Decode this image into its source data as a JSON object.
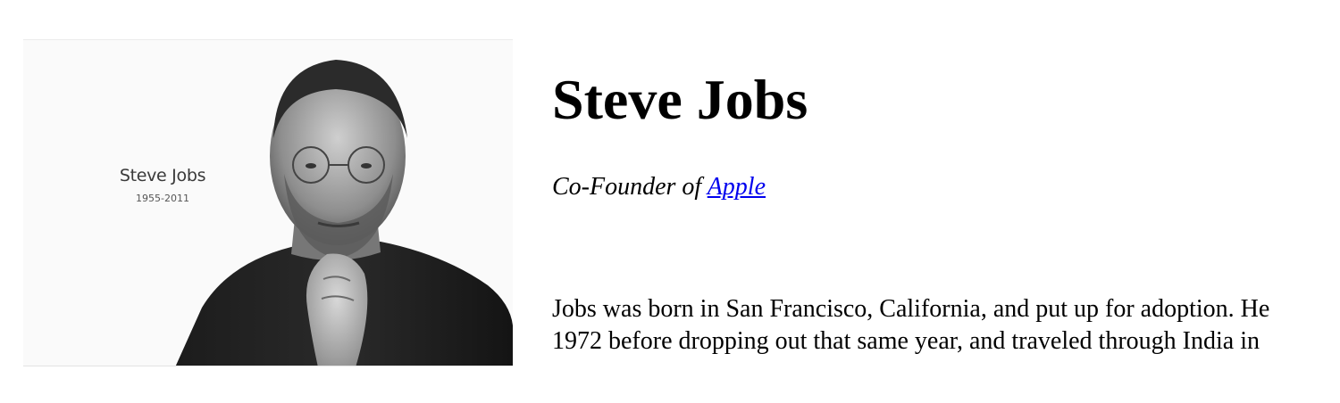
{
  "profile": {
    "name": "Steve Jobs",
    "subtitle_prefix": "Co-Founder of ",
    "company_link": "Apple",
    "bio_lines": [
      "Jobs was born in San Francisco, California, and put up for adoption. He",
      "1972 before dropping out that same year, and traveled through India in"
    ]
  },
  "portrait": {
    "caption_name": "Steve Jobs",
    "caption_years": "1955-2011"
  },
  "colors": {
    "link": "#0000ee",
    "text": "#000000",
    "background": "#ffffff"
  }
}
